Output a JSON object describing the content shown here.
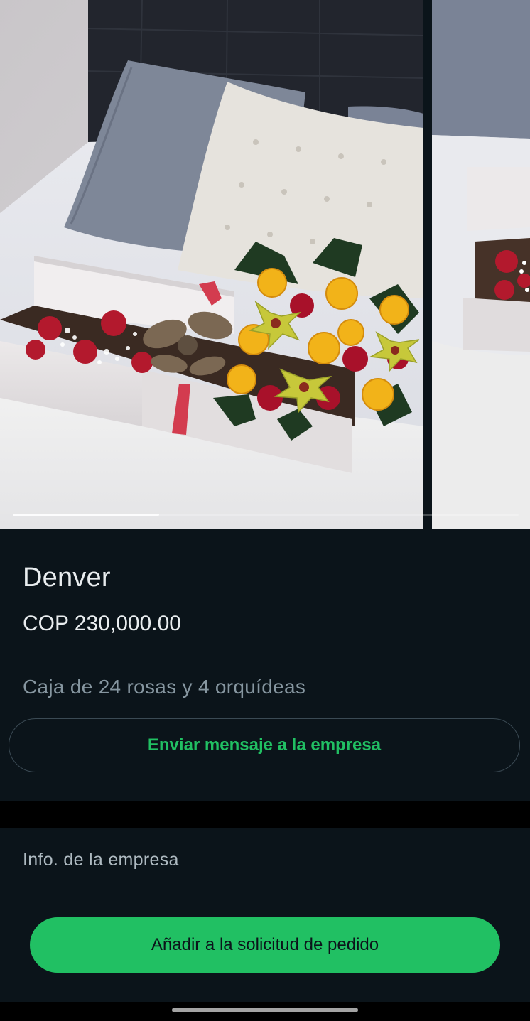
{
  "carousel": {
    "images": [
      {
        "icon": "flower-box-photo"
      },
      {
        "icon": "flower-box-photo-partial"
      }
    ],
    "progress": 0.29
  },
  "product": {
    "name": "Denver",
    "price": "COP 230,000.00",
    "description": "Caja de 24 rosas y 4 orquídeas",
    "message_button": "Enviar mensaje a la empresa"
  },
  "business": {
    "info_label": "Info. de la empresa",
    "add_button": "Añadir a la solicitud de pedido"
  },
  "colors": {
    "background": "#0b141a",
    "accent_green": "#21c063",
    "text_primary": "#e9edef",
    "text_secondary": "#8696a0"
  }
}
